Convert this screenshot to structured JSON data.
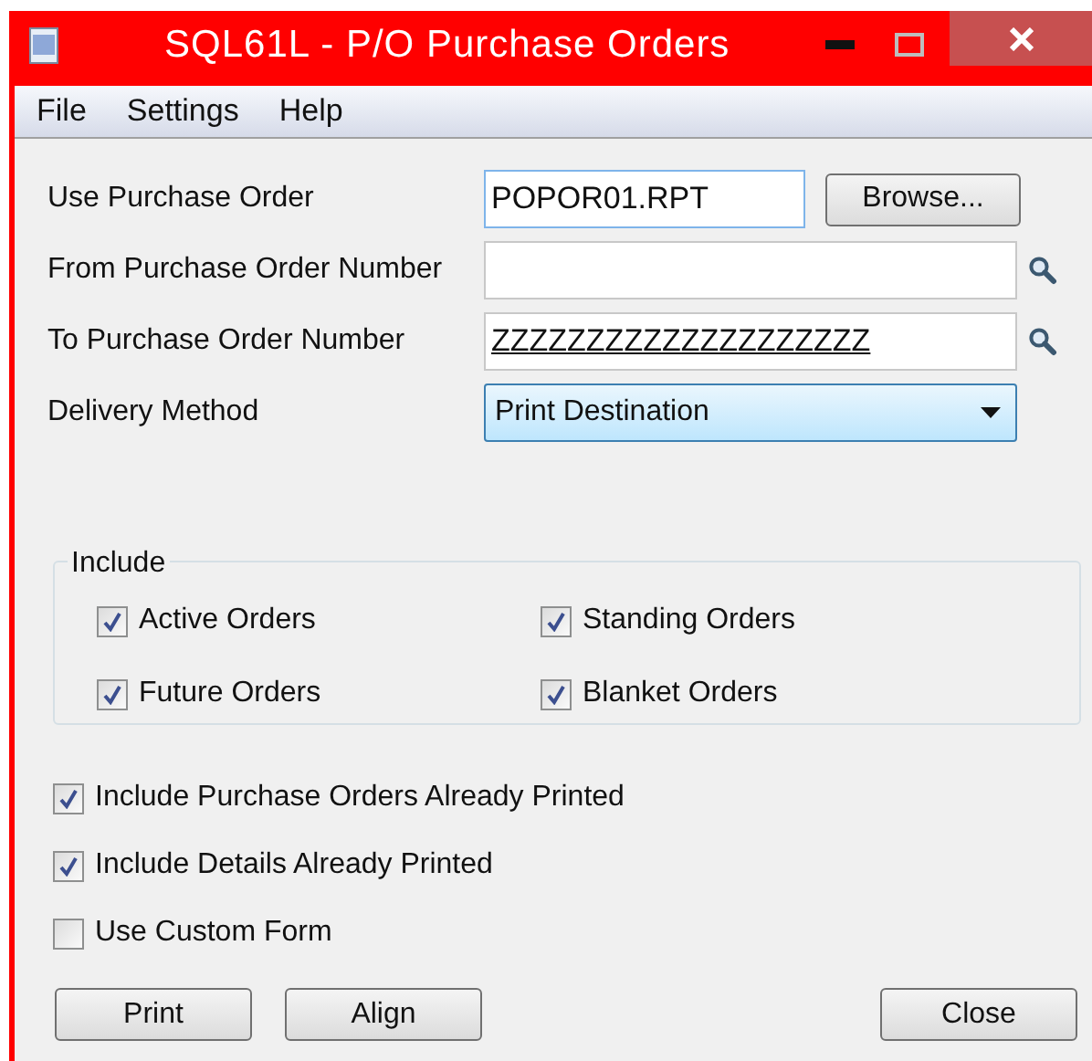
{
  "window": {
    "title": "SQL61L - P/O Purchase Orders"
  },
  "menu": [
    "File",
    "Settings",
    "Help"
  ],
  "fields": [
    {
      "kind": "file",
      "label": "Use Purchase Order",
      "value": "POPOR01.RPT",
      "button": "Browse..."
    },
    {
      "kind": "lookup",
      "label": "From Purchase Order Number"
    },
    {
      "kind": "lookup",
      "label": "To Purchase Order Number",
      "value": "ZZZZZZZZZZZZZZZZZZZZ"
    },
    {
      "kind": "dropdown",
      "label": "Delivery Method",
      "value": "Print Destination"
    }
  ],
  "include": {
    "title": "Include",
    "options": [
      {
        "label": "Active Orders",
        "checked": true
      },
      {
        "label": "Standing Orders",
        "checked": true
      },
      {
        "label": "Future Orders",
        "checked": true
      },
      {
        "label": "Blanket Orders",
        "checked": true
      }
    ]
  },
  "options": [
    {
      "label": "Include Purchase Orders Already Printed",
      "checked": true
    },
    {
      "label": "Include Details Already Printed",
      "checked": true
    },
    {
      "label": "Use Custom Form",
      "checked": false
    }
  ],
  "buttons": [
    {
      "label": "Print"
    },
    {
      "label": "Align"
    },
    {
      "label": "Close"
    }
  ]
}
